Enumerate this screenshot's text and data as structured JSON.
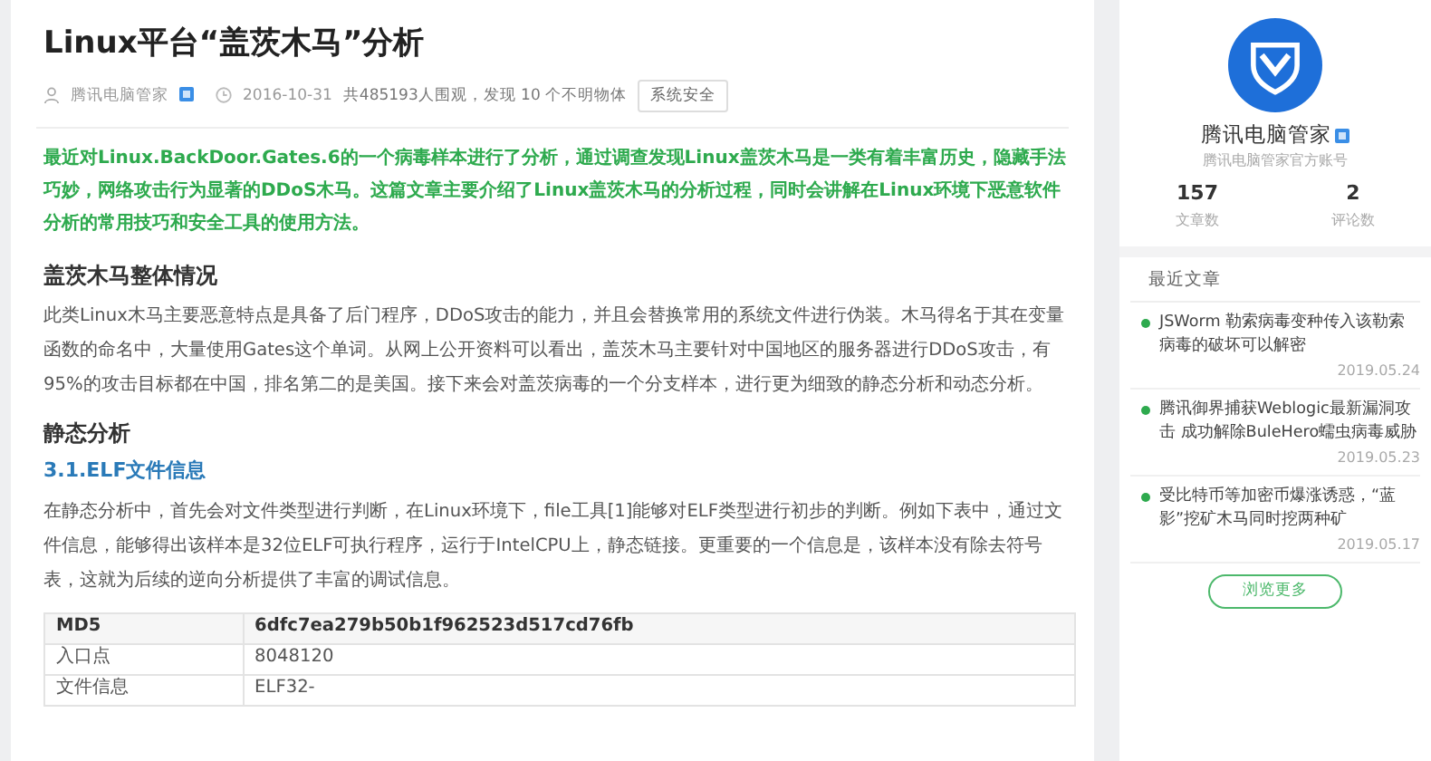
{
  "article": {
    "title": "Linux平台“盖茨木马”分析",
    "author": "腾讯电脑管家",
    "date": "2016-10-31",
    "views": "共485193人围观，发现 10 个不明物体",
    "tag": "系统安全",
    "summary": "最近对Linux.BackDoor.Gates.6的一个病毒样本进行了分析，通过调查发现Linux盖茨木马是一类有着丰富历史，隐藏手法巧妙，网络攻击行为显著的DDoS木马。这篇文章主要介绍了Linux盖茨木马的分析过程，同时会讲解在Linux环境下恶意软件分析的常用技巧和安全工具的使用方法。",
    "blocks": [
      {
        "kind": "heading",
        "text": "盖茨木马整体情况"
      },
      {
        "kind": "paragraph",
        "text": "此类Linux木马主要恶意特点是具备了后门程序，DDoS攻击的能力，并且会替换常用的系统文件进行伪装。木马得名于其在变量函数的命名中，大量使用Gates这个单词。从网上公开资料可以看出，盖茨木马主要针对中国地区的服务器进行DDoS攻击，有95%的攻击目标都在中国，排名第二的是美国。接下来会对盖茨病毒的一个分支样本，进行更为细致的静态分析和动态分析。"
      },
      {
        "kind": "heading",
        "text": "静态分析"
      },
      {
        "kind": "subheading",
        "text": "3.1.ELF文件信息"
      },
      {
        "kind": "paragraph",
        "text": "在静态分析中，首先会对文件类型进行判断，在Linux环境下，file工具[1]能够对ELF类型进行初步的判断。例如下表中，通过文件信息，能够得出该样本是32位ELF可执行程序，运行于IntelCPU上，静态链接。更重要的一个信息是，该样本没有除去符号表，这就为后续的逆向分析提供了丰富的调试信息。"
      }
    ],
    "table": {
      "columns": [
        "MD5",
        "6dfc7ea279b50b1f962523d517cd76fb"
      ],
      "rows": [
        [
          "入口点",
          "8048120"
        ],
        [
          "文件信息",
          "ELF32-"
        ]
      ]
    }
  },
  "sidebar": {
    "name": "腾讯电脑管家",
    "description": "腾讯电脑管家官方账号",
    "stats": [
      {
        "value": "157",
        "label": "文章数"
      },
      {
        "value": "2",
        "label": "评论数"
      }
    ],
    "recent_title": "最近文章",
    "recent": [
      {
        "title": "JSWorm 勒索病毒变种传入该勒索病毒的破坏可以解密",
        "date": "2019.05.24"
      },
      {
        "title": "腾讯御界捕获Weblogic最新漏洞攻击 成功解除BuleHero蠕虫病毒威胁",
        "date": "2019.05.23"
      },
      {
        "title": "受比特币等加密币爆涨诱惑，“蓝影”挖矿木马同时挖两种矿",
        "date": "2019.05.17"
      }
    ],
    "more_button": "浏览更多"
  }
}
